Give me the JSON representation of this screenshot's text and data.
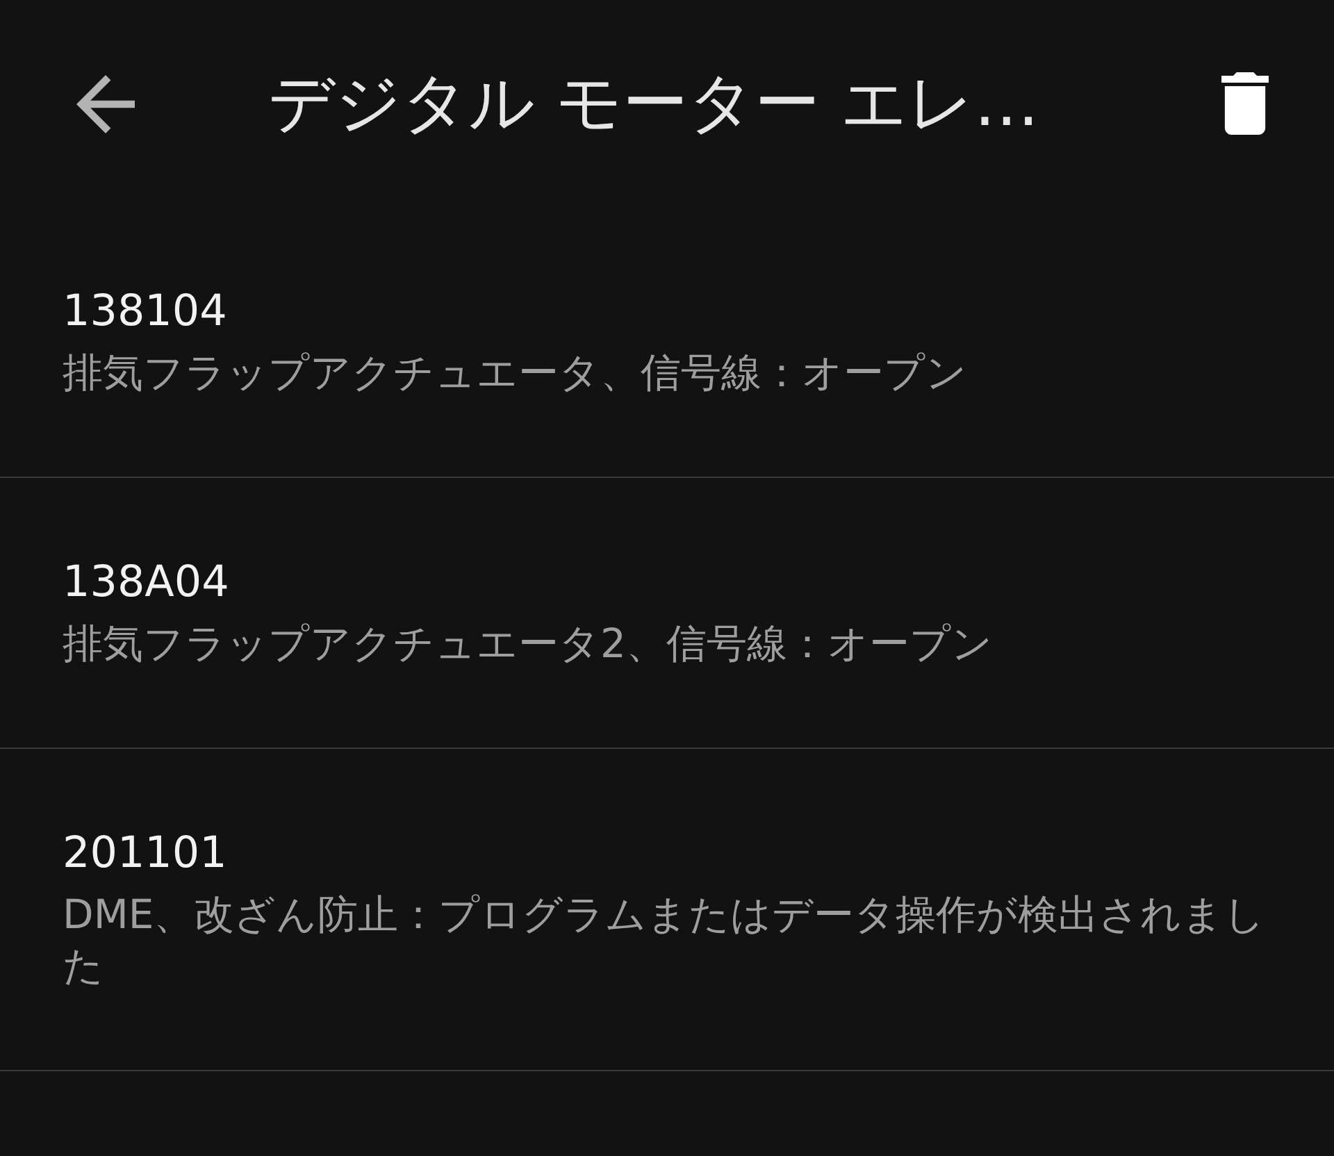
{
  "app_bar": {
    "title": "デジタル モーター エレ…"
  },
  "faults": [
    {
      "code": "138104",
      "description": "排気フラップアクチュエータ、信号線：オープン"
    },
    {
      "code": "138A04",
      "description": "排気フラップアクチュエータ2、信号線：オープン"
    },
    {
      "code": "201101",
      "description": "DME、改ざん防止：プログラムまたはデータ操作が検出されました"
    }
  ]
}
